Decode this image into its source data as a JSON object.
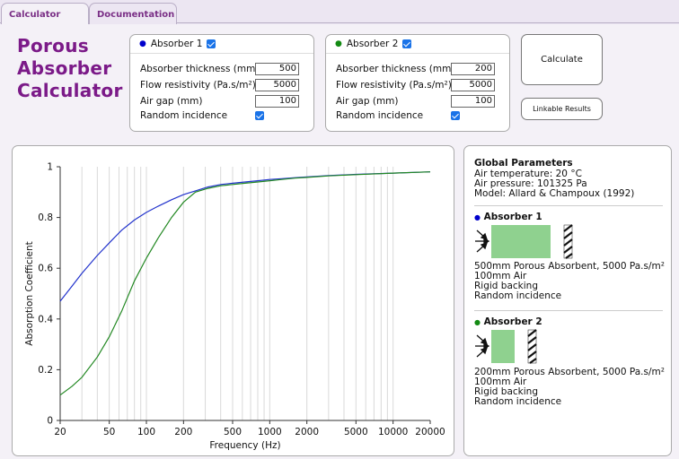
{
  "tabs": [
    {
      "label": "Calculator",
      "active": true
    },
    {
      "label": "Documentation",
      "active": false
    }
  ],
  "logo": {
    "lines": [
      "Porous",
      "Absorber",
      "Calculator"
    ]
  },
  "absorbers": [
    {
      "title": "Absorber 1",
      "dot_color": "#0000cc",
      "enabled": true,
      "fields": [
        {
          "label": "Absorber thickness (mm)",
          "value": "500"
        },
        {
          "label": "Flow resistivity (Pa.s/m²)",
          "value": "5000"
        },
        {
          "label": "Air gap (mm)",
          "value": "100"
        }
      ],
      "random_label": "Random incidence",
      "random_checked": true
    },
    {
      "title": "Absorber 2",
      "dot_color": "#138a13",
      "enabled": true,
      "fields": [
        {
          "label": "Absorber thickness (mm)",
          "value": "200"
        },
        {
          "label": "Flow resistivity (Pa.s/m²)",
          "value": "5000"
        },
        {
          "label": "Air gap (mm)",
          "value": "100"
        }
      ],
      "random_label": "Random incidence",
      "random_checked": true
    }
  ],
  "buttons": {
    "calculate": "Calculate",
    "linkable": "Linkable Results"
  },
  "chart_data": {
    "type": "line",
    "title": "",
    "xlabel": "Frequency (Hz)",
    "ylabel": "Absorption Coefficient",
    "xscale": "log",
    "xlim": [
      20,
      20000
    ],
    "ylim": [
      0,
      1
    ],
    "x_tick_labels": [
      "20",
      "50",
      "100",
      "200",
      "500",
      "1000",
      "2000",
      "5000",
      "10000",
      "20000"
    ],
    "y_tick_labels": [
      "0",
      "0.2",
      "0.4",
      "0.6",
      "0.8",
      "1"
    ],
    "grid": "vertical minor lines",
    "legend": "none",
    "series": [
      {
        "color": "#2233cc",
        "x": [
          20,
          25,
          30,
          40,
          50,
          63,
          80,
          100,
          125,
          160,
          200,
          250,
          315,
          400,
          500,
          630,
          800,
          1000,
          1250,
          1600,
          2000,
          3000,
          5000,
          10000,
          20000
        ],
        "y": [
          0.47,
          0.53,
          0.58,
          0.65,
          0.7,
          0.75,
          0.79,
          0.82,
          0.845,
          0.87,
          0.89,
          0.905,
          0.92,
          0.93,
          0.935,
          0.94,
          0.945,
          0.95,
          0.953,
          0.957,
          0.96,
          0.965,
          0.97,
          0.975,
          0.98
        ]
      },
      {
        "color": "#228822",
        "x": [
          20,
          25,
          30,
          40,
          50,
          63,
          80,
          100,
          125,
          160,
          200,
          250,
          315,
          400,
          500,
          630,
          800,
          1000,
          1250,
          1600,
          2000,
          3000,
          5000,
          10000,
          20000
        ],
        "y": [
          0.1,
          0.135,
          0.17,
          0.25,
          0.33,
          0.43,
          0.55,
          0.64,
          0.72,
          0.8,
          0.86,
          0.9,
          0.915,
          0.925,
          0.93,
          0.935,
          0.94,
          0.945,
          0.95,
          0.955,
          0.958,
          0.964,
          0.969,
          0.975,
          0.98
        ]
      }
    ]
  },
  "global": {
    "title": "Global Parameters",
    "lines": [
      "Air temperature: 20 °C",
      "Air pressure: 101325 Pa",
      "Model: Allard & Champoux (1992)"
    ]
  },
  "info_absorbers": [
    {
      "title": "Absorber 1",
      "dot_color": "#0000cc",
      "lines": [
        "500mm Porous Absorbent, 5000 Pa.s/m²",
        "100mm Air",
        "Rigid backing",
        "Random incidence"
      ]
    },
    {
      "title": "Absorber 2",
      "dot_color": "#138a13",
      "lines": [
        "200mm Porous Absorbent, 5000 Pa.s/m²",
        "100mm Air",
        "Rigid backing",
        "Random incidence"
      ]
    }
  ],
  "colors": {
    "accent": "#7b1a88",
    "absorbent_fill": "#8fd18f",
    "checkbox": "#1a73e8"
  }
}
